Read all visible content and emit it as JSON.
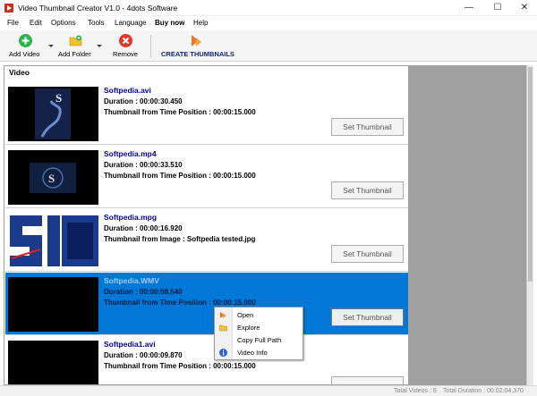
{
  "window": {
    "title": "Video Thumbnail Creator V1.0 - 4dots Software"
  },
  "menu": [
    "File",
    "Edit",
    "Options",
    "Tools",
    "Language",
    "Buy now",
    "Help"
  ],
  "toolbar": {
    "add_video": "Add Video",
    "add_folder": "Add Folder",
    "remove": "Remove",
    "create": "CREATE THUMBNAILS"
  },
  "panel": {
    "header": "Video"
  },
  "videos": [
    {
      "name": "Softpedia.avi",
      "duration": "Duration : 00:00:30.450",
      "source": "Thumbnail from Time Position : 00:00:15.000",
      "button": "Set Thumbnail"
    },
    {
      "name": "Softpedia.mp4",
      "duration": "Duration : 00:00:33.510",
      "source": "Thumbnail from Time Position : 00:00:15.000",
      "button": "Set Thumbnail"
    },
    {
      "name": "Softpedia.mpg",
      "duration": "Duration : 00:00:16.920",
      "source": "Thumbnail from Image : Softpedia tested.jpg",
      "button": "Set Thumbnail"
    },
    {
      "name": "Softpedia.WMV",
      "duration": "Duration : 00:00:08.540",
      "source": "Thumbnail from Time Position : 00:00:15.000",
      "button": "Set Thumbnail"
    },
    {
      "name": "Softpedia1.avi",
      "duration": "Duration : 00:00:09.870",
      "source": "Thumbnail from Time Position : 00:00:15.000"
    }
  ],
  "context_menu": [
    "Open",
    "Explore",
    "Copy Full Path",
    "Video Info"
  ],
  "status": {
    "total_videos": "Total Videos : 6",
    "total_duration": "Total Duration : 00:02:04.370"
  },
  "colors": {
    "selection": "#0078d7",
    "title_link": "#0000a0"
  }
}
